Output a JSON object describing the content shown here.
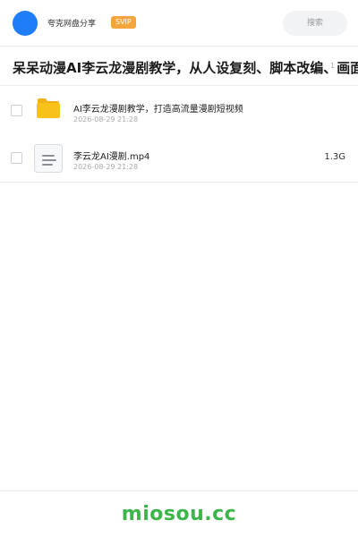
{
  "header": {
    "brand": "夸克网盘分享",
    "badge": "SVIP",
    "search_placeholder": "搜索"
  },
  "share": {
    "title": "呆呆动漫AI李云龙漫剧教学，从人设复刻、脚本改编、画面",
    "count": "1"
  },
  "files": [
    {
      "type": "folder",
      "icon": "folder-icon",
      "name": "AI李云龙漫剧教学，打造高流量漫剧短视频",
      "date": "2026-08-29 21:28",
      "size": ""
    },
    {
      "type": "video",
      "icon": "document-icon",
      "name": "李云龙AI漫剧.mp4",
      "date": "2026-08-29 21:28",
      "size": "1.3G"
    }
  ],
  "footer": {
    "watermark": "miosou.cc"
  },
  "colors": {
    "accent": "#1e7df7",
    "badge": "#f4a53b",
    "folder": "#f9c21b",
    "watermark": "#3cb54a"
  }
}
